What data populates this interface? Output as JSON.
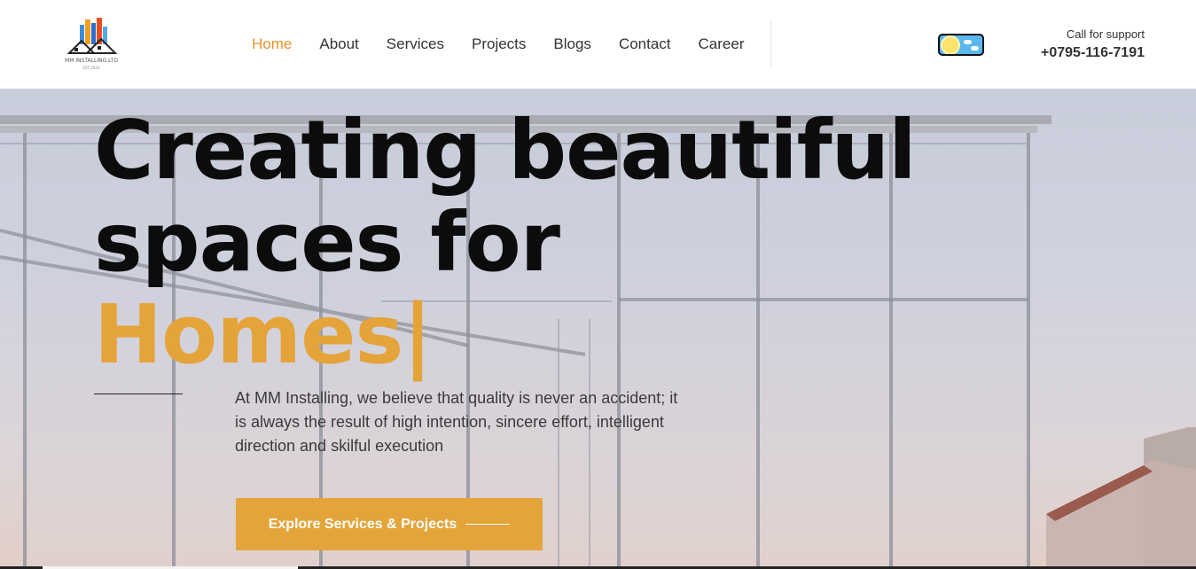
{
  "header": {
    "logo": {
      "icon": "house-skyline-logo",
      "text": "MM INSTALLING LTD",
      "subtext": "EST 2023"
    },
    "nav": [
      {
        "label": "Home",
        "active": true
      },
      {
        "label": "About",
        "active": false
      },
      {
        "label": "Services",
        "active": false
      },
      {
        "label": "Projects",
        "active": false
      },
      {
        "label": "Blogs",
        "active": false
      },
      {
        "label": "Contact",
        "active": false
      },
      {
        "label": "Career",
        "active": false
      }
    ],
    "theme_toggle": {
      "icon": "sun-cloud-toggle-icon",
      "mode": "light"
    },
    "support": {
      "label": "Call for support",
      "phone": "+0795-116-7191"
    }
  },
  "hero": {
    "title_line1": "Creating beautiful",
    "title_line2": "spaces for",
    "title_accent": "Homes|",
    "description": "At MM Installing, we believe that quality is never an accident; it is always the result of high intention, sincere effort, intelligent direction and skilful execution",
    "cta_label": "Explore Services & Projects"
  },
  "colors": {
    "accent": "#e4a43a",
    "nav_active": "#e8912c",
    "text_dark": "#0c0c0c"
  }
}
